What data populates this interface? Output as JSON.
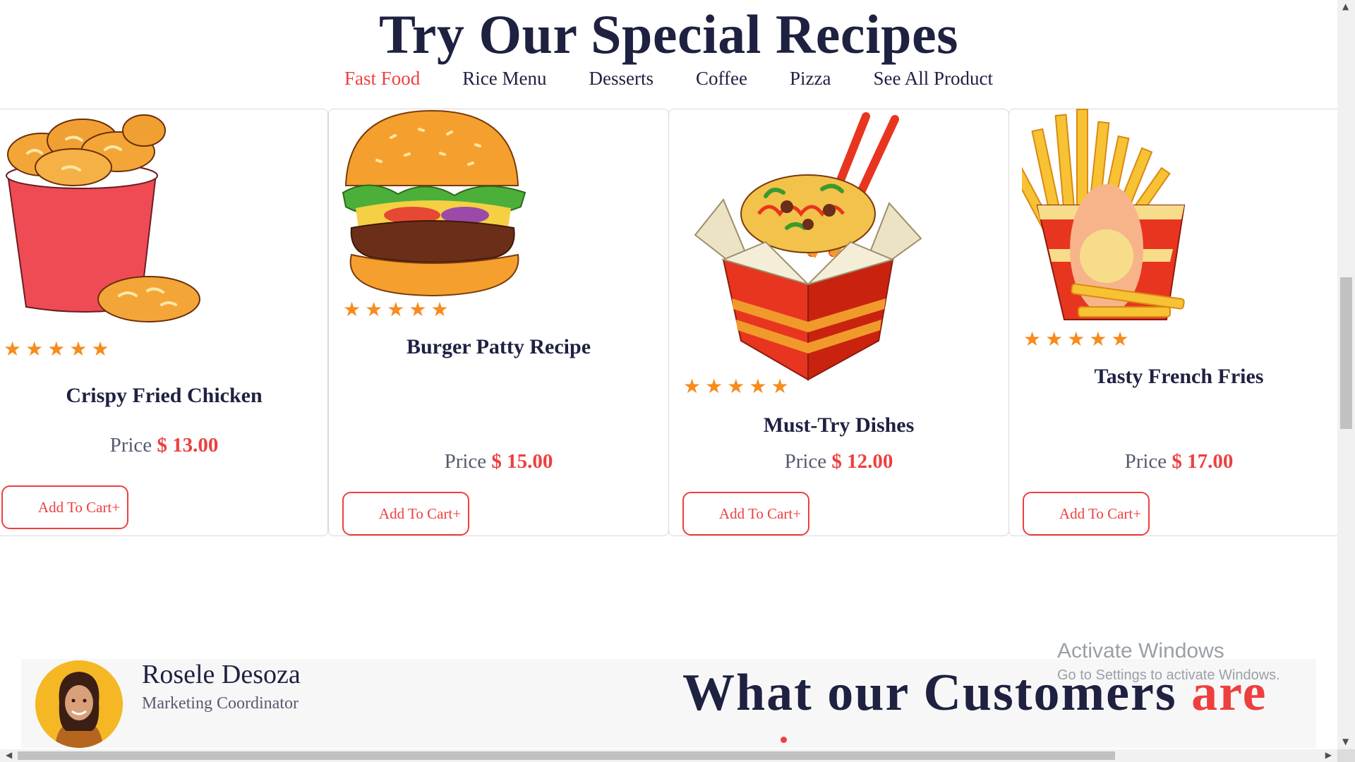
{
  "header": {
    "title": "Try Our Special Recipes"
  },
  "tabs": [
    {
      "label": "Fast Food",
      "active": true
    },
    {
      "label": "Rice Menu",
      "active": false
    },
    {
      "label": "Desserts",
      "active": false
    },
    {
      "label": "Coffee",
      "active": false
    },
    {
      "label": "Pizza",
      "active": false
    },
    {
      "label": "See All Product",
      "active": false
    }
  ],
  "products": [
    {
      "name": "Crispy Fried Chicken",
      "price_label": "Price",
      "price": "$ 13.00",
      "rating": 5,
      "cart_label": "Add To Cart+",
      "icon": "fried-chicken-icon"
    },
    {
      "name": "Burger Patty Recipe",
      "price_label": "Price",
      "price": "$ 15.00",
      "rating": 5,
      "cart_label": "Add To Cart+",
      "icon": "burger-icon"
    },
    {
      "name": "Must-Try Dishes",
      "price_label": "Price",
      "price": "$ 12.00",
      "rating": 5,
      "cart_label": "Add To Cart+",
      "icon": "noodle-box-icon"
    },
    {
      "name": "Tasty French Fries",
      "price_label": "Price",
      "price": "$ 17.00",
      "rating": 5,
      "cart_label": "Add To Cart+",
      "icon": "french-fries-icon"
    }
  ],
  "testimonial": {
    "name": "Rosele Desoza",
    "role": "Marketing Coordinator",
    "section_title_main": "What our Customers ",
    "section_title_highlight": "are"
  },
  "watermark": {
    "line1": "Activate Windows",
    "line2": "Go to Settings to activate Windows."
  },
  "colors": {
    "accent": "#ee3f3f",
    "heading": "#1e2140",
    "star": "#f68b1e"
  }
}
